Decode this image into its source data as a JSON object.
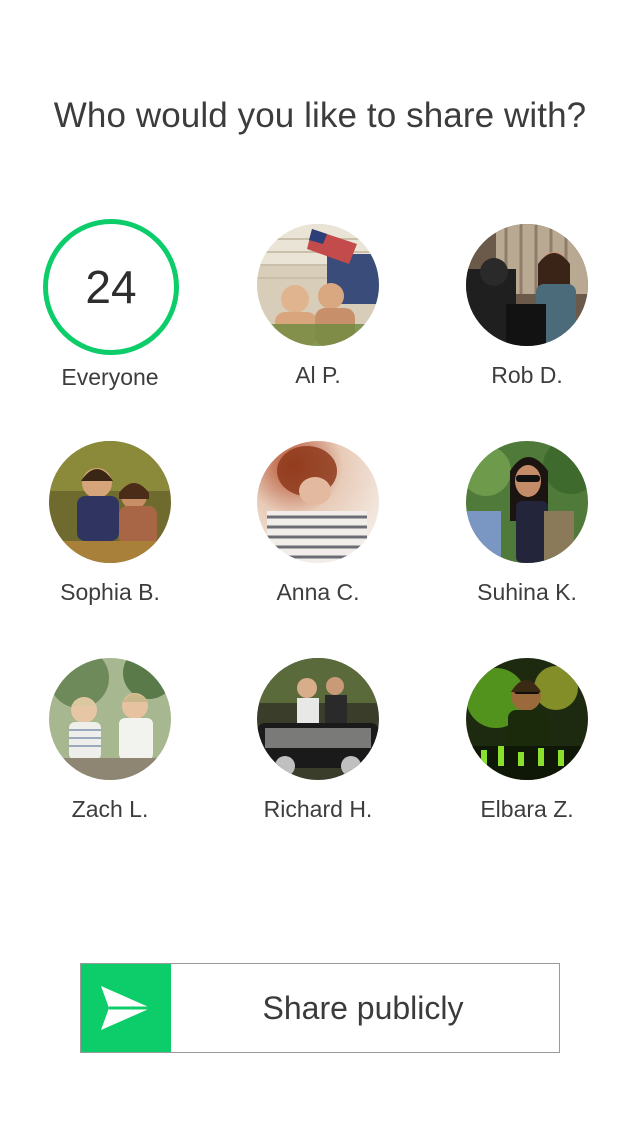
{
  "header": {
    "title": "Who would you like to share with?"
  },
  "everyone": {
    "count": "24",
    "label": "Everyone",
    "ring_color": "#0dcd6a"
  },
  "contacts": [
    {
      "name": "Al P.",
      "photo": "two-boys-flag-photo"
    },
    {
      "name": "Rob D.",
      "photo": "people-on-porch-photo"
    },
    {
      "name": "Sophia B.",
      "photo": "two-children-vintage-photo"
    },
    {
      "name": "Anna C.",
      "photo": "woman-striped-shirt-photo"
    },
    {
      "name": "Suhina K.",
      "photo": "woman-sunglasses-photo"
    },
    {
      "name": "Zach L.",
      "photo": "two-toddlers-photo"
    },
    {
      "name": "Richard H.",
      "photo": "people-at-car-photo"
    },
    {
      "name": "Elbara Z.",
      "photo": "man-green-lights-photo"
    }
  ],
  "share_button": {
    "label": "Share publicly",
    "icon": "paper-plane-icon",
    "accent": "#0dcd6a"
  }
}
